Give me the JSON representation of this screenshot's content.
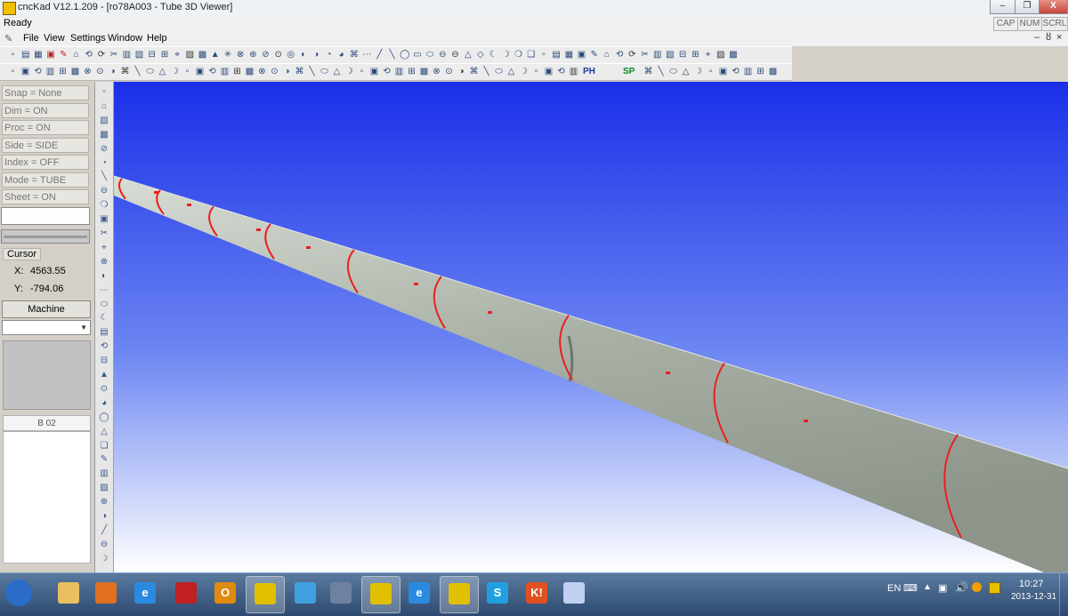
{
  "window": {
    "title": "cncKad V12.1.209 - [ro78A003 - Tube 3D Viewer]",
    "minimize_label": "–",
    "restore_label": "❐",
    "close_label": "X",
    "mdi_minimize": "–",
    "mdi_restore": "ȣ",
    "mdi_close": "×"
  },
  "status": {
    "ready": "Ready",
    "indicators": [
      "CAP",
      "NUM",
      "SCRL"
    ]
  },
  "menu": [
    "File",
    "View",
    "Settings",
    "Window",
    "Help"
  ],
  "toolbar2": {
    "ph": "PH",
    "sp": "SP"
  },
  "left_panel": {
    "state_buttons": [
      "Snap = None",
      "Dim = ON",
      "Proc = ON",
      "Side = SIDE",
      "Index = OFF",
      "Mode = TUBE",
      "Sheet = ON"
    ],
    "cursor_label": "Cursor",
    "x_label": "X:",
    "x_value": "4563.55",
    "y_label": "Y:",
    "y_value": "-794.06",
    "machine_label": "Machine",
    "b_label": "B 02"
  },
  "taskbar": {
    "lang": "EN",
    "time": "10:27",
    "date": "2013-12-31",
    "apps": [
      {
        "name": "start-orb",
        "label": ""
      },
      {
        "name": "explorer",
        "label": ""
      },
      {
        "name": "media-player",
        "label": ""
      },
      {
        "name": "internet-explorer",
        "label": "e"
      },
      {
        "name": "grid-app",
        "label": ""
      },
      {
        "name": "outlook",
        "label": "O"
      },
      {
        "name": "cnckad",
        "label": ""
      },
      {
        "name": "messenger",
        "label": ""
      },
      {
        "name": "app-window",
        "label": ""
      },
      {
        "name": "cnckad-2",
        "label": ""
      },
      {
        "name": "internet-explorer-2",
        "label": "e"
      },
      {
        "name": "cnckad-v12",
        "label": ""
      },
      {
        "name": "skype",
        "label": "S"
      },
      {
        "name": "kt-app",
        "label": "K!"
      },
      {
        "name": "paint",
        "label": ""
      }
    ]
  },
  "colors": {
    "viewport_top": "#1a2ee8",
    "viewport_bottom": "#ffffff",
    "tube": "#a9b1a6",
    "cut": "#e82020"
  }
}
